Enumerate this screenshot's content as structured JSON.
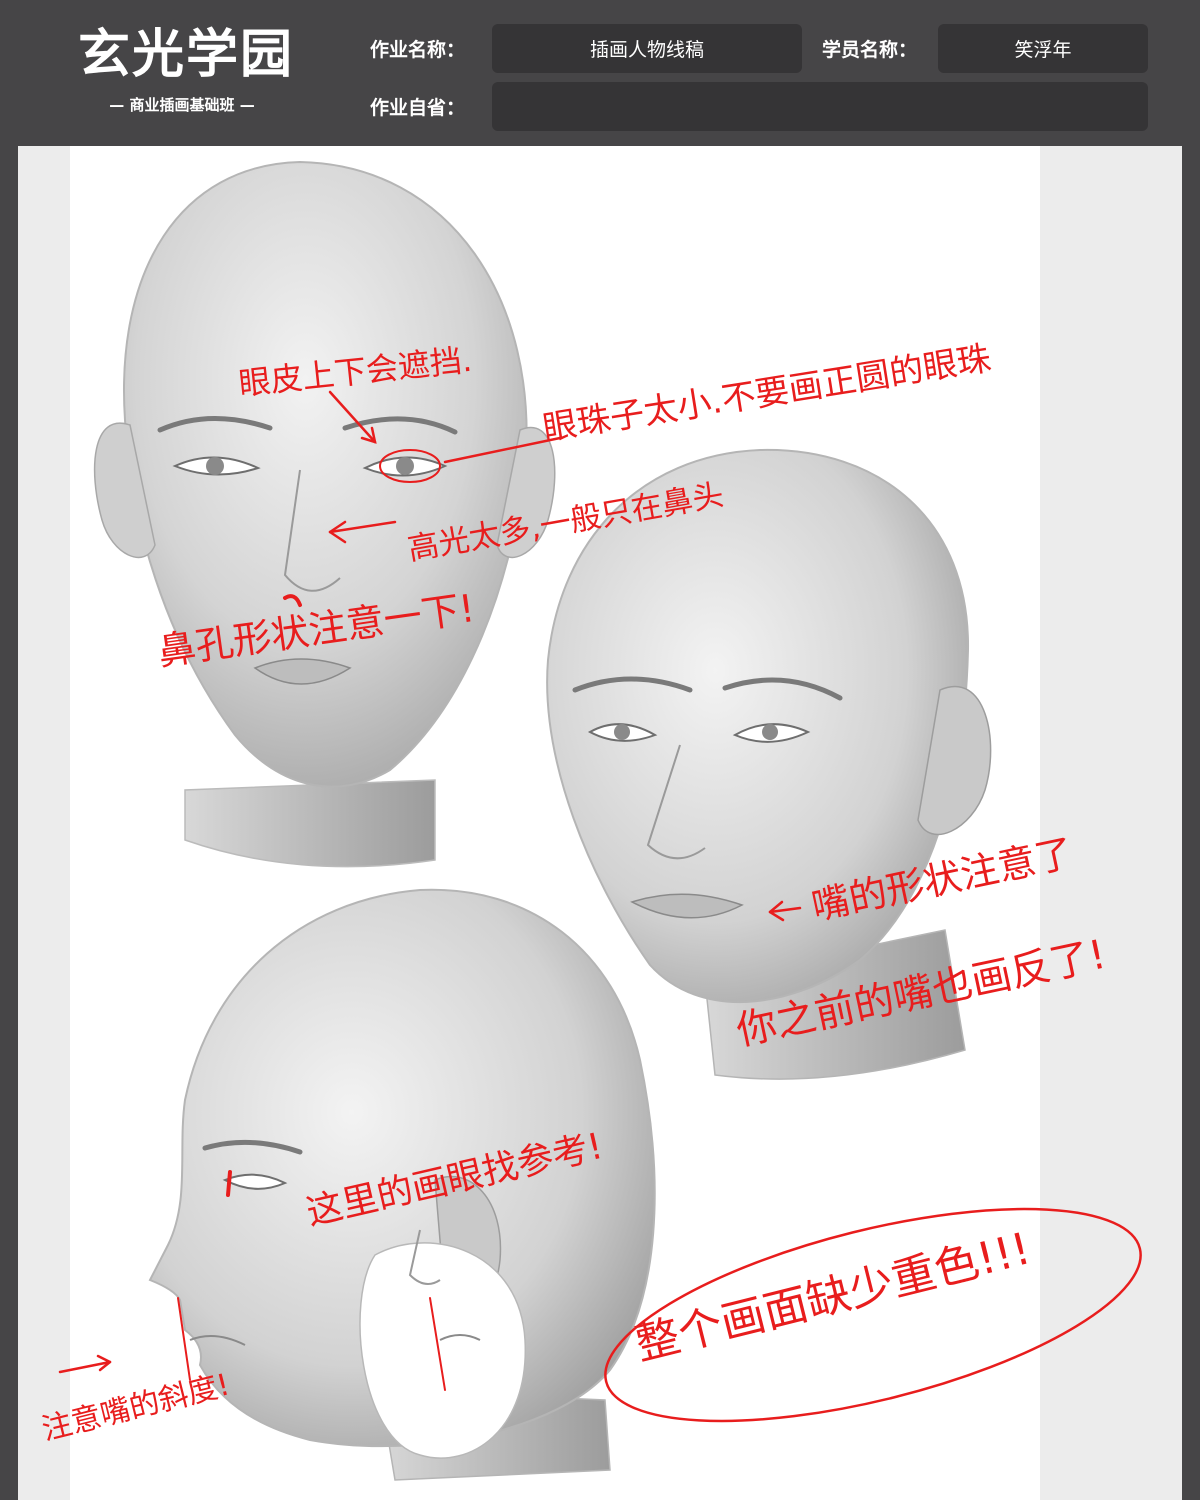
{
  "header": {
    "brand_title": "玄光学园",
    "brand_subtitle": "— 商业插画基础班 —",
    "assignment_name_label": "作业名称：",
    "assignment_name_value": "插画人物线稿",
    "student_name_label": "学员名称：",
    "student_name_value": "笑浮年",
    "self_review_label": "作业自省：",
    "self_review_value": ""
  },
  "annotations": {
    "eyelid_note": "眼皮上下会遮挡.",
    "eyeball_note": "眼珠子太小.不要画正圆的眼珠",
    "highlight_note": "高光太多,一般只在鼻头",
    "nostril_note": "鼻孔形状注意一下!",
    "mouth_shape_note": "嘴的形状注意了",
    "mouth_ref_note": "你之前的嘴也画反了!",
    "ear_ref_note": "这里的画眼找参考!",
    "lip_angle_note": "注意嘴的斜度!",
    "overall_note": "整个画面缺少重色!!!"
  },
  "colors": {
    "header_bg": "#464547",
    "field_bg": "#353436",
    "annotation_red": "#e81d1d",
    "paper": "#ffffff"
  }
}
